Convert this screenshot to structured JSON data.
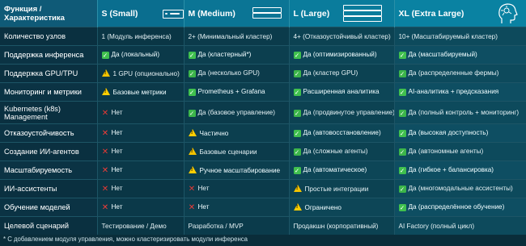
{
  "header": {
    "feature": "Функция / Характеристика",
    "s": "S (Small)",
    "m": "M (Medium)",
    "l": "L (Large)",
    "xl": "XL (Extra Large)"
  },
  "rows": [
    {
      "label": "Количество узлов",
      "s": {
        "icon": "none",
        "text": "1 (Модуль инференса)"
      },
      "m": {
        "icon": "none",
        "text": "2+ (Минимальный кластер)"
      },
      "l": {
        "icon": "none",
        "text": "4+ (Отказоустойчивый кластер)"
      },
      "xl": {
        "icon": "none",
        "text": "10+ (Масштабируемый кластер)"
      }
    },
    {
      "label": "Поддержка инференса",
      "s": {
        "icon": "check",
        "text": "Да (локальный)"
      },
      "m": {
        "icon": "check",
        "text": "Да (кластерный*)"
      },
      "l": {
        "icon": "check",
        "text": "Да (оптимизированный)"
      },
      "xl": {
        "icon": "check",
        "text": "Да (масштабируемый)"
      }
    },
    {
      "label": "Поддержка GPU/TPU",
      "s": {
        "icon": "warn",
        "text": "1 GPU (опционально)"
      },
      "m": {
        "icon": "check",
        "text": "Да (несколько GPU)"
      },
      "l": {
        "icon": "check",
        "text": "Да (кластер GPU)"
      },
      "xl": {
        "icon": "check",
        "text": "Да (распределенные фермы)"
      }
    },
    {
      "label": "Мониторинг и метрики",
      "s": {
        "icon": "warn",
        "text": "Базовые метрики"
      },
      "m": {
        "icon": "check",
        "text": "Prometheus + Grafana"
      },
      "l": {
        "icon": "check",
        "text": "Расширенная аналитика"
      },
      "xl": {
        "icon": "check",
        "text": "AI-аналитика + предсказания"
      }
    },
    {
      "label": "Kubernetes (k8s) Management",
      "s": {
        "icon": "cross",
        "text": "Нет"
      },
      "m": {
        "icon": "check",
        "text": "Да (базовое управление)"
      },
      "l": {
        "icon": "check",
        "text": "Да (продвинутое управление)"
      },
      "xl": {
        "icon": "check",
        "text": "Да (полный контроль + мониторинг)"
      }
    },
    {
      "label": "Отказоустойчивость",
      "s": {
        "icon": "cross",
        "text": "Нет"
      },
      "m": {
        "icon": "warn",
        "text": "Частично"
      },
      "l": {
        "icon": "check",
        "text": "Да (автовосстановление)"
      },
      "xl": {
        "icon": "check",
        "text": "Да (высокая доступность)"
      }
    },
    {
      "label": "Создание ИИ-агентов",
      "s": {
        "icon": "cross",
        "text": "Нет"
      },
      "m": {
        "icon": "warn",
        "text": "Базовые сценарии"
      },
      "l": {
        "icon": "check",
        "text": "Да (сложные агенты)"
      },
      "xl": {
        "icon": "check",
        "text": "Да (автономные агенты)"
      }
    },
    {
      "label": "Масштабируемость",
      "s": {
        "icon": "cross",
        "text": "Нет"
      },
      "m": {
        "icon": "warn",
        "text": "Ручное масштабирование"
      },
      "l": {
        "icon": "check",
        "text": "Да (автоматическое)"
      },
      "xl": {
        "icon": "check",
        "text": "Да (гибкое + балансировка)"
      }
    },
    {
      "label": "ИИ-ассистенты",
      "s": {
        "icon": "cross",
        "text": "Нет"
      },
      "m": {
        "icon": "cross",
        "text": "Нет"
      },
      "l": {
        "icon": "warn",
        "text": "Простые интеграции"
      },
      "xl": {
        "icon": "check",
        "text": "Да (многомодальные ассистенты)"
      }
    },
    {
      "label": "Обучение моделей",
      "s": {
        "icon": "cross",
        "text": "Нет"
      },
      "m": {
        "icon": "cross",
        "text": "Нет"
      },
      "l": {
        "icon": "warn",
        "text": "Ограничено"
      },
      "xl": {
        "icon": "check",
        "text": "Да (распределённое обучение)"
      }
    },
    {
      "label": "Целевой сценарий",
      "s": {
        "icon": "none",
        "text": "Тестирование / Демо"
      },
      "m": {
        "icon": "none",
        "text": "Разработка / MVP"
      },
      "l": {
        "icon": "none",
        "text": "Продакшн (корпоративный)"
      },
      "xl": {
        "icon": "none",
        "text": "AI Factory (полный цикл)"
      }
    }
  ],
  "footnote": "* С добавлением модуля управления, можно кластеризировать модули инференса",
  "colors": {
    "check": "#3cb54a",
    "cross": "#e53935",
    "warn": "#f2c200",
    "header": "#0d6c8a",
    "background": "#0a2d3a"
  }
}
